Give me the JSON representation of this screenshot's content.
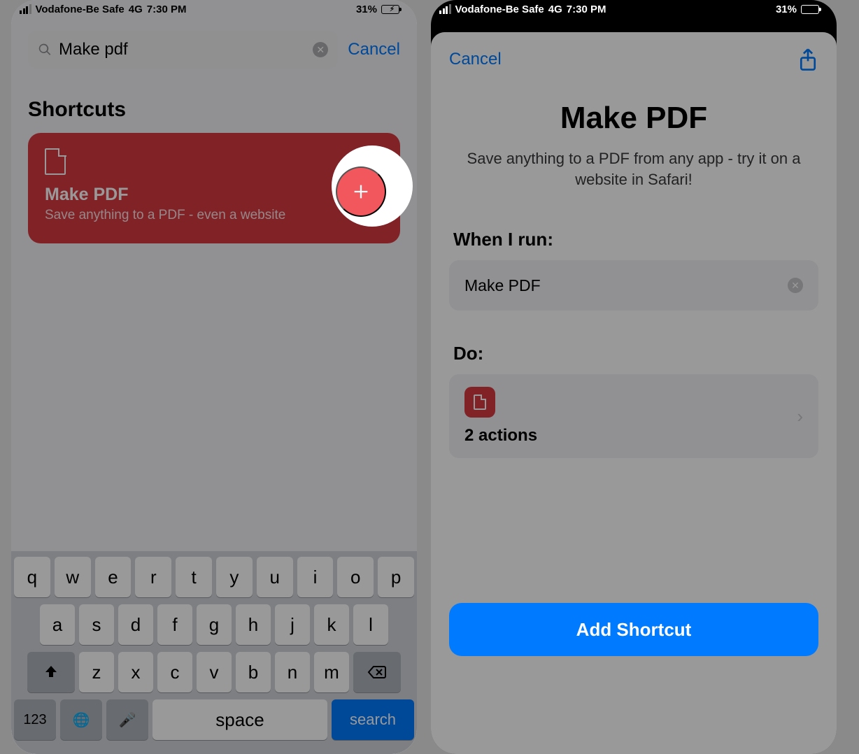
{
  "status": {
    "carrier": "Vodafone-Be Safe",
    "network": "4G",
    "time": "7:30 PM",
    "battery_pct": "31%"
  },
  "left": {
    "search_value": "Make pdf",
    "cancel": "Cancel",
    "section": "Shortcuts",
    "card": {
      "title": "Make PDF",
      "subtitle": "Save anything to a PDF - even a website"
    }
  },
  "right": {
    "cancel": "Cancel",
    "hero_title": "Make PDF",
    "hero_sub": "Save anything to a PDF from any app - try it on a website in Safari!",
    "when_label": "When I run:",
    "when_value": "Make PDF",
    "do_label": "Do:",
    "action_count": "2 actions",
    "add_button": "Add Shortcut"
  },
  "keyboard": {
    "row1": [
      "q",
      "w",
      "e",
      "r",
      "t",
      "y",
      "u",
      "i",
      "o",
      "p"
    ],
    "row2": [
      "a",
      "s",
      "d",
      "f",
      "g",
      "h",
      "j",
      "k",
      "l"
    ],
    "row3": [
      "z",
      "x",
      "c",
      "v",
      "b",
      "n",
      "m"
    ],
    "numkey": "123",
    "space": "space",
    "search": "search"
  }
}
